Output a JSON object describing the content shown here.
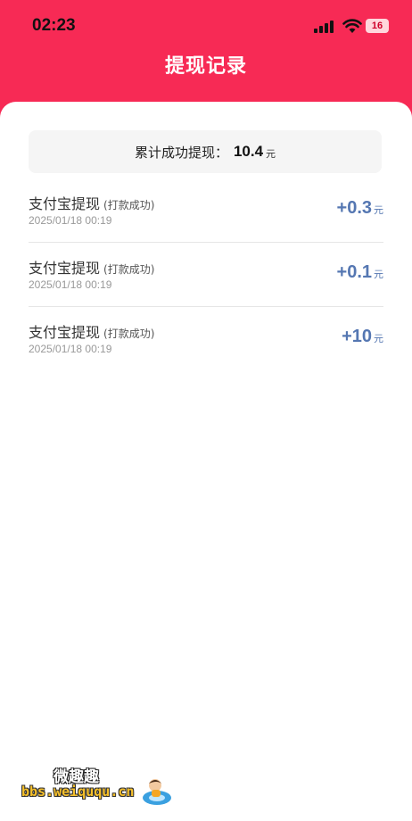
{
  "status_bar": {
    "time": "02:23",
    "battery": "16"
  },
  "header": {
    "title": "提现记录"
  },
  "summary": {
    "label": "累计成功提现：",
    "amount": "10.4",
    "unit": "元"
  },
  "records": [
    {
      "title": "支付宝提现",
      "status": "(打款成功)",
      "time": "2025/01/18 00:19",
      "amount": "+0.3",
      "unit": "元"
    },
    {
      "title": "支付宝提现",
      "status": "(打款成功)",
      "time": "2025/01/18 00:19",
      "amount": "+0.1",
      "unit": "元"
    },
    {
      "title": "支付宝提现",
      "status": "(打款成功)",
      "time": "2025/01/18 00:19",
      "amount": "+10",
      "unit": "元"
    }
  ],
  "watermark": {
    "site_name": "微趣趣",
    "url": "bbs.weiququ.cn"
  },
  "colors": {
    "header_bg": "#f72a55",
    "amount": "#5577b2"
  }
}
